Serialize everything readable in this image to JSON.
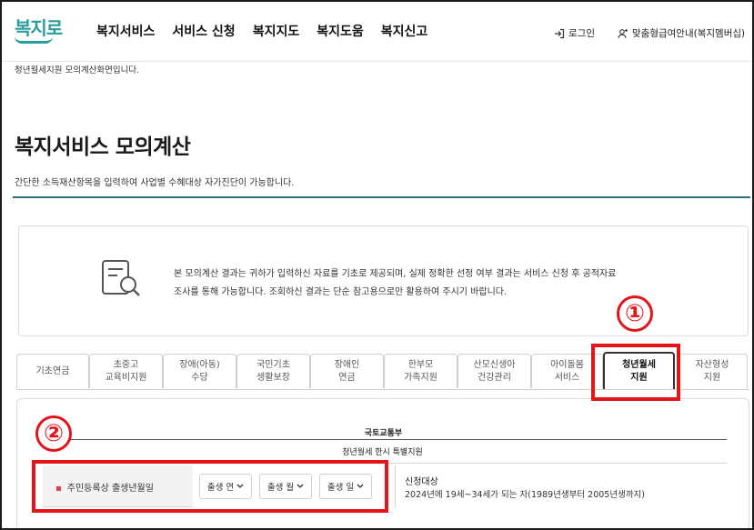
{
  "header": {
    "logo": "복지로",
    "nav": [
      "복지서비스",
      "서비스 신청",
      "복지지도",
      "복지도움",
      "복지신고"
    ],
    "login_label": "로그인",
    "guide_label": "맞춤형급여안내(복지멤버십)"
  },
  "breadcrumb_text": "청년월세지원 모의계산화면입니다.",
  "page": {
    "title": "복지서비스 모의계산",
    "subtitle": "간단한 소득재산항목을 입력하여 사업별 수혜대상 자가진단이 가능합니다."
  },
  "notice": {
    "line1": "본 모의계산 결과는 귀하가 입력하신 자료를 기초로 제공되며, 실제 정확한 선정 여부 결과는 서비스 신청 후 공적자료",
    "line2": "조사를 통해 가능합니다. 조회하신 결과는 단순 참고용으로만 활용하여 주시기 바랍니다."
  },
  "tabs": [
    {
      "line1": "기초연금",
      "line2": ""
    },
    {
      "line1": "초중고",
      "line2": "교육비지원"
    },
    {
      "line1": "장애(아동)",
      "line2": "수당"
    },
    {
      "line1": "국민기초",
      "line2": "생활보장"
    },
    {
      "line1": "장애인",
      "line2": "연금"
    },
    {
      "line1": "한부모",
      "line2": "가족지원"
    },
    {
      "line1": "산모신생아",
      "line2": "건강관리"
    },
    {
      "line1": "아이돌봄",
      "line2": "서비스"
    },
    {
      "line1": "청년월세",
      "line2": "지원"
    },
    {
      "line1": "자산형성",
      "line2": "지원"
    }
  ],
  "active_tab_index": 8,
  "content": {
    "ministry": "국토교통부",
    "program": "청년월세 한시 특별지원",
    "field_label": "주민등록상 출생년월일",
    "selects": [
      "출생 연",
      "출생 월",
      "출생 일"
    ],
    "eligibility_title": "신청대상",
    "eligibility_desc": "2024년에 19세~34세가 되는 자(1989년생부터 2005년생까지)"
  },
  "annotations": {
    "marker1": "①",
    "marker2": "②",
    "color": "#e4141b"
  },
  "colors": {
    "brand": "#2a9d9d",
    "title_rule": "#2f6e6e",
    "required_bullet": "#e63946"
  }
}
